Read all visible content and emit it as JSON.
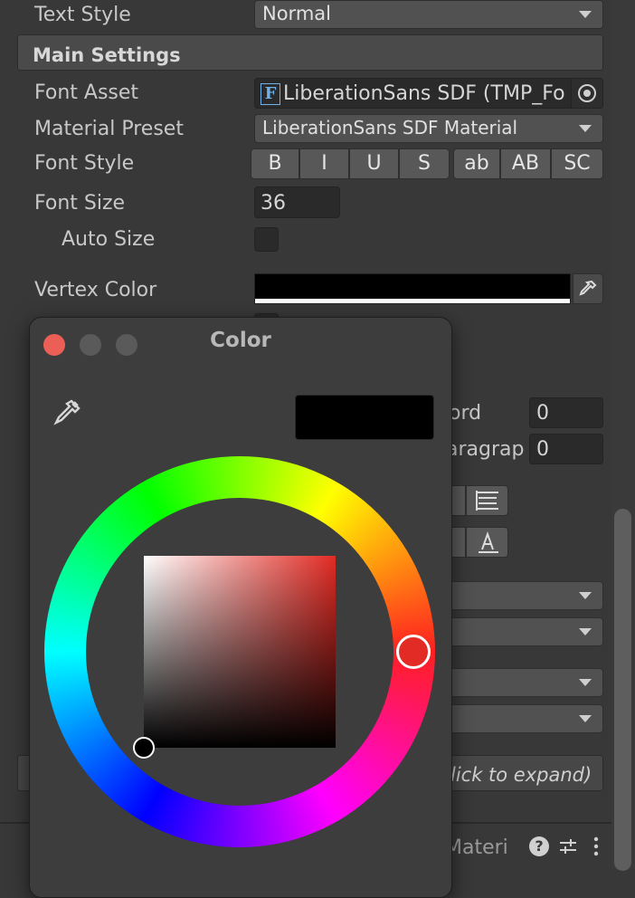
{
  "inspector": {
    "text_style": {
      "label": "Text Style",
      "value": "Normal"
    },
    "main_settings": {
      "title": "Main Settings"
    },
    "font_asset": {
      "label": "Font Asset",
      "value": "LiberationSans SDF (TMP_Fo",
      "icon_glyph": "F"
    },
    "material_preset": {
      "label": "Material Preset",
      "value": "LiberationSans SDF Material"
    },
    "font_style": {
      "label": "Font Style",
      "buttons": [
        "B",
        "I",
        "U",
        "S",
        "ab",
        "AB",
        "SC"
      ]
    },
    "font_size": {
      "label": "Font Size",
      "value": "36"
    },
    "auto_size": {
      "label": "Auto Size",
      "checked": false
    },
    "vertex_color": {
      "label": "Vertex Color",
      "color": "#000000"
    },
    "spacing": {
      "word_label_fragment": "ord",
      "word_value": "0",
      "paragraph_label_fragment": "aragrap",
      "paragraph_value": "0"
    },
    "foldout_fragment": "lick to expand)",
    "footer": {
      "material_fragment": "Materi"
    }
  },
  "color_picker": {
    "title": "Color",
    "current_color": "#000000",
    "hue_color": "#e22b24"
  },
  "icons": [
    "object-picker-icon",
    "eyedropper-icon",
    "help-icon",
    "preset-icon",
    "more-icon",
    "align-justify-icon",
    "align-flush-icon",
    "align-vertical-icon"
  ]
}
